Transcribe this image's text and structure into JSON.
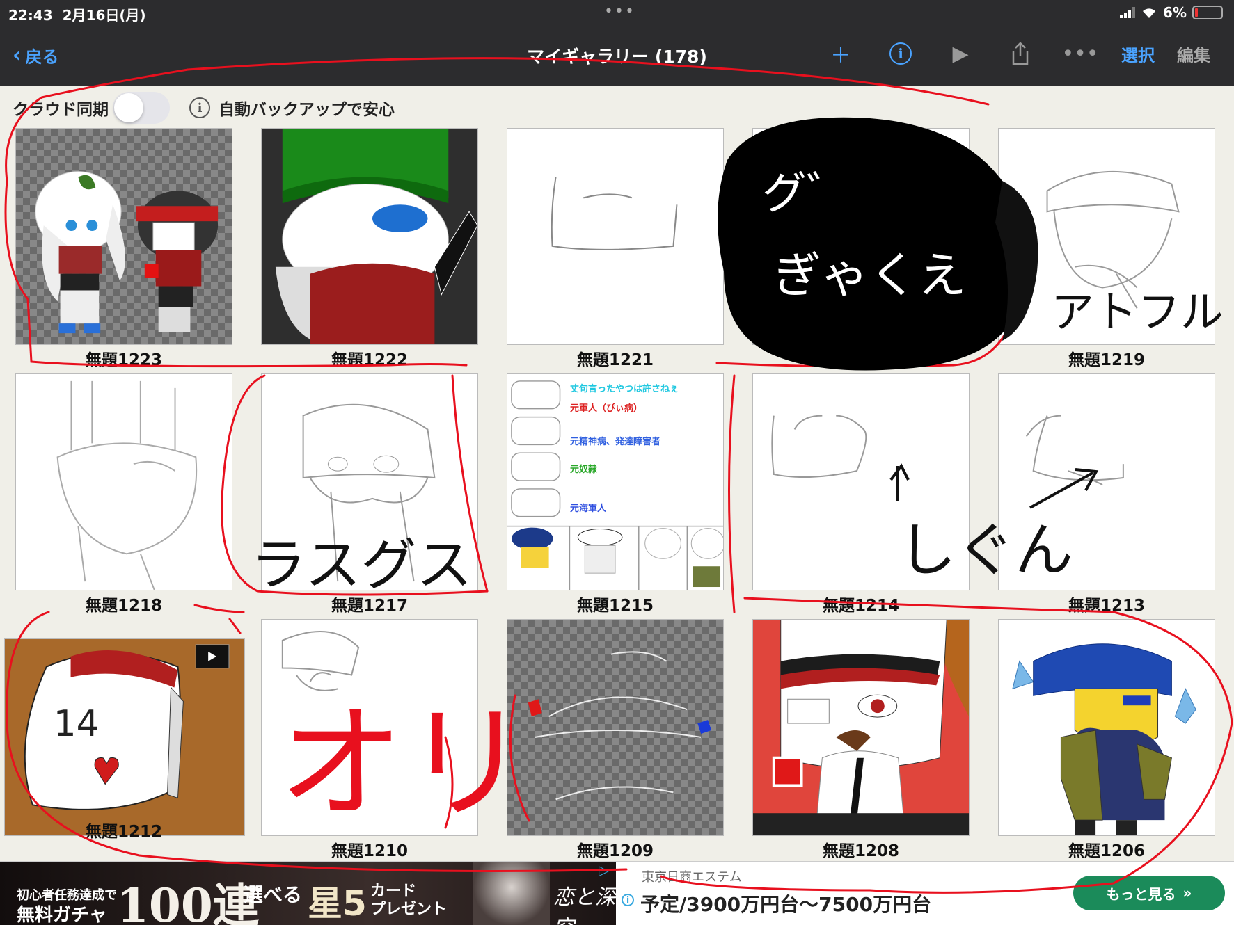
{
  "status": {
    "time": "22:43",
    "date": "2月16日(月)",
    "battery": "6%"
  },
  "nav": {
    "back": "戻る",
    "title": "マイギャラリー (178)",
    "select": "選択",
    "edit": "編集"
  },
  "toolbar": {
    "cloud_sync": "クラウド同期",
    "backup": "自動バックアップで安心"
  },
  "gallery": [
    {
      "label": "無題1223"
    },
    {
      "label": "無題1222"
    },
    {
      "label": "無題1221"
    },
    {
      "label": ""
    },
    {
      "label": "無題1219"
    },
    {
      "label": "無題1218"
    },
    {
      "label": "無題1217"
    },
    {
      "label": "無題1215"
    },
    {
      "label": "無題1214"
    },
    {
      "label": "無題1213"
    },
    {
      "label": "無題1212"
    },
    {
      "label": "無題1210"
    },
    {
      "label": "無題1209"
    },
    {
      "label": "無題1208"
    },
    {
      "label": "無題1206"
    }
  ],
  "scribbles": {
    "tile4_a": "グ゛",
    "tile4_b": "ぎゃくえ",
    "tile5": "アトフル",
    "tile7": "ラスグス",
    "tile9": "しぐん",
    "tile12": "オリ",
    "tile11_thumb": "14"
  },
  "tile8_text": [
    "元軍人（ぴぃ病）",
    "元精神病、発達障害者",
    "元奴隷",
    "元海軍人"
  ],
  "ad": {
    "line1": "初心者任務達成で",
    "line2": "無料ガチャ",
    "big": "100連",
    "choose": "選べる",
    "star": "星5",
    "present": "カード\nプレゼント",
    "logo": "恋と深空",
    "brand": "東京日商エステム",
    "main": "予定/3900万円台〜7500万円台",
    "cta": "もっと見る"
  }
}
